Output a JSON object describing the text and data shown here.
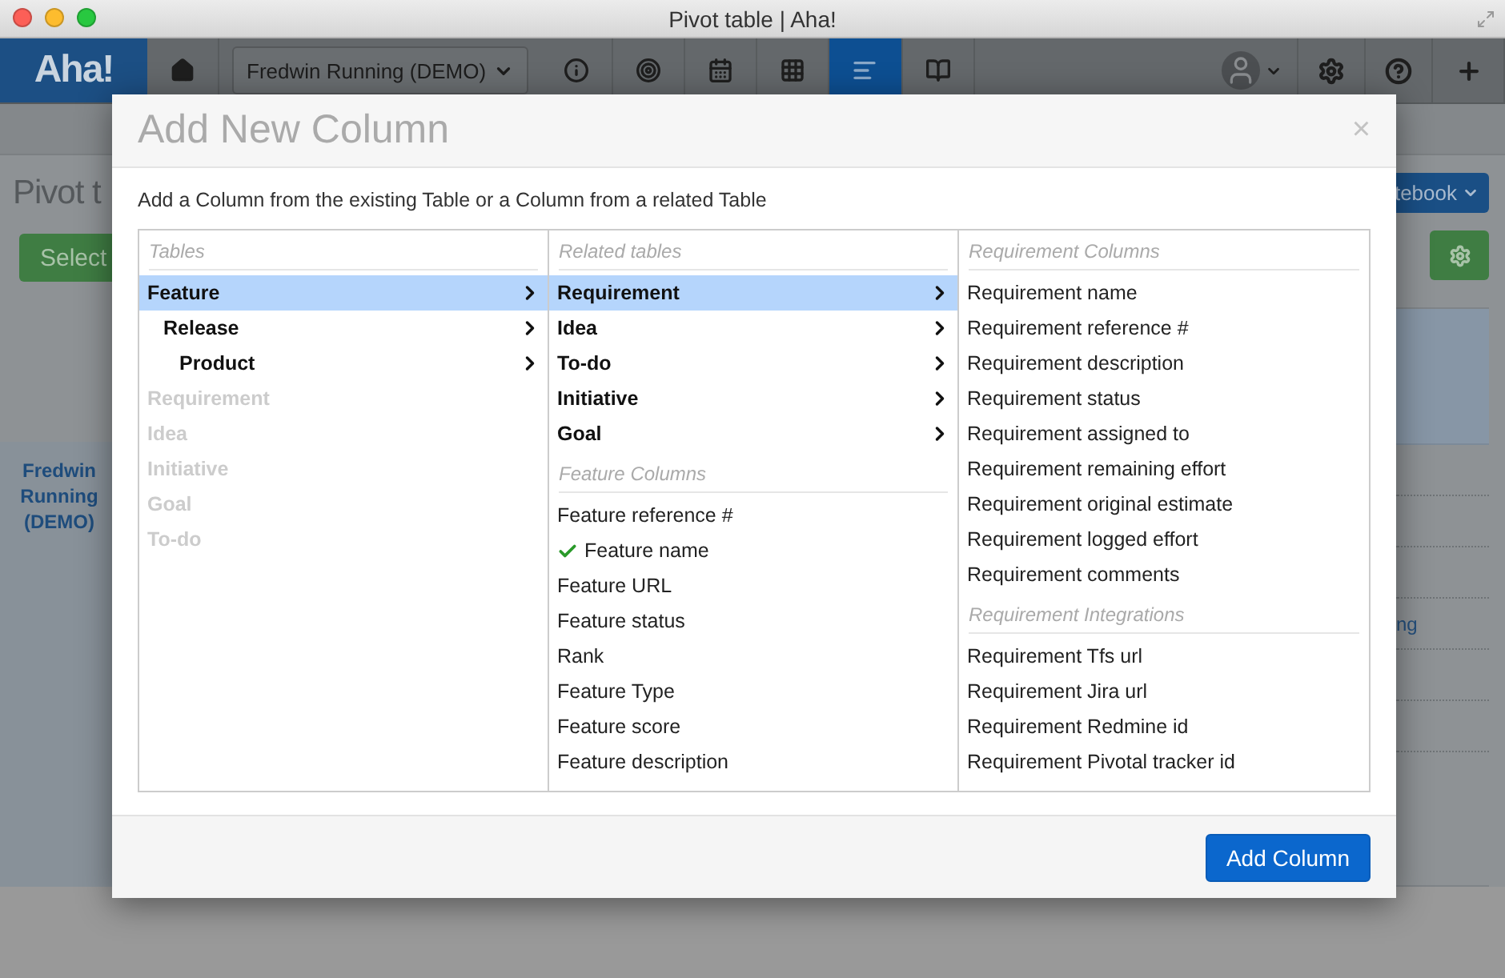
{
  "window": {
    "title": "Pivot table | Aha!"
  },
  "nav": {
    "logo": "Aha!",
    "product": "Fredwin Running (DEMO)",
    "items": [
      {
        "kind": "home",
        "selected": false
      },
      {
        "kind": "info",
        "selected": false
      },
      {
        "kind": "target",
        "selected": false
      },
      {
        "kind": "calendar",
        "selected": false
      },
      {
        "kind": "grid",
        "selected": false
      },
      {
        "kind": "list",
        "selected": true
      },
      {
        "kind": "book",
        "selected": false
      }
    ],
    "right": [
      {
        "kind": "avatar"
      },
      {
        "kind": "settings"
      },
      {
        "kind": "help"
      },
      {
        "kind": "plus"
      }
    ]
  },
  "page": {
    "heading": "Pivot t",
    "select_button": "Select",
    "workspace_link": "Fredwin Running (DEMO)",
    "notebook_button": "tebook",
    "cell_text": "ng"
  },
  "modal": {
    "title": "Add New Column",
    "close": "×",
    "description": "Add a Column from the existing Table or a Column from a related Table",
    "tables": {
      "header": "Tables",
      "items": [
        {
          "label": "Feature",
          "selected": true,
          "disabled": false,
          "expandable": true,
          "children": [
            {
              "label": "Release",
              "selected": false,
              "disabled": false,
              "expandable": true,
              "children": [
                {
                  "label": "Product",
                  "selected": false,
                  "disabled": false,
                  "expandable": true
                }
              ]
            }
          ]
        },
        {
          "label": "Requirement",
          "selected": false,
          "disabled": true,
          "expandable": false
        },
        {
          "label": "Idea",
          "selected": false,
          "disabled": true,
          "expandable": false
        },
        {
          "label": "Initiative",
          "selected": false,
          "disabled": true,
          "expandable": false
        },
        {
          "label": "Goal",
          "selected": false,
          "disabled": true,
          "expandable": false
        },
        {
          "label": "To-do",
          "selected": false,
          "disabled": true,
          "expandable": false
        }
      ]
    },
    "related": {
      "header": "Related tables",
      "items": [
        {
          "label": "Requirement",
          "selected": true
        },
        {
          "label": "Idea",
          "selected": false
        },
        {
          "label": "To-do",
          "selected": false
        },
        {
          "label": "Initiative",
          "selected": false
        },
        {
          "label": "Goal",
          "selected": false
        }
      ],
      "section": "Feature Columns",
      "columns": [
        {
          "label": "Feature reference #",
          "checked": false
        },
        {
          "label": "Feature name",
          "checked": true
        },
        {
          "label": "Feature URL",
          "checked": false
        },
        {
          "label": "Feature status",
          "checked": false
        },
        {
          "label": "Rank",
          "checked": false
        },
        {
          "label": "Feature Type",
          "checked": false
        },
        {
          "label": "Feature score",
          "checked": false
        },
        {
          "label": "Feature description",
          "checked": false
        }
      ]
    },
    "requirement": {
      "header": "Requirement Columns",
      "columns": [
        {
          "label": "Requirement name",
          "checked": false
        },
        {
          "label": "Requirement reference #",
          "checked": false
        },
        {
          "label": "Requirement description",
          "checked": false
        },
        {
          "label": "Requirement status",
          "checked": false
        },
        {
          "label": "Requirement assigned to",
          "checked": false
        },
        {
          "label": "Requirement remaining effort",
          "checked": false
        },
        {
          "label": "Requirement original estimate",
          "checked": false
        },
        {
          "label": "Requirement logged effort",
          "checked": false
        },
        {
          "label": "Requirement comments",
          "checked": false
        }
      ],
      "section": "Requirement Integrations",
      "integrations": [
        {
          "label": "Requirement Tfs url",
          "checked": false
        },
        {
          "label": "Requirement Jira url",
          "checked": false
        },
        {
          "label": "Requirement Redmine id",
          "checked": false
        },
        {
          "label": "Requirement Pivotal tracker id",
          "checked": false
        }
      ]
    },
    "button": "Add Column"
  }
}
